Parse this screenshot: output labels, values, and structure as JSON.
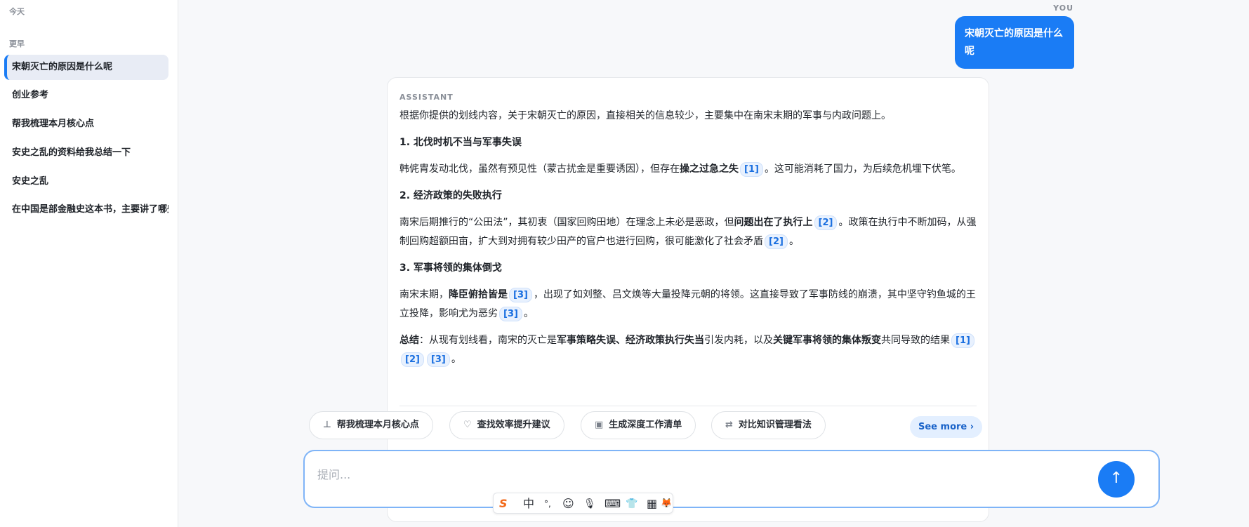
{
  "sidebar": {
    "groups": [
      {
        "label": "今天"
      },
      {
        "label": "更早"
      }
    ],
    "items": [
      {
        "label": "宋朝灭亡的原因是什么呢",
        "active": true
      },
      {
        "label": "创业参考"
      },
      {
        "label": "帮我梳理本月核心点"
      },
      {
        "label": "安史之乱的资料给我总结一下"
      },
      {
        "label": "安史之乱"
      },
      {
        "label": "在中国是部金融史这本书，主要讲了哪些内容"
      }
    ]
  },
  "chat": {
    "you_label": "YOU",
    "user_message": "宋朝灭亡的原因是什么呢",
    "assistant_label": "ASSISTANT",
    "answer": {
      "intro": "根据你提供的划线内容，关于宋朝灭亡的原因，直接相关的信息较少，主要集中在南宋末期的军事与内政问题上。",
      "s1_title": "1. 北伐时机不当与军事失误",
      "s1_a": "韩侂胄发动北伐，虽然有预见性（蒙古扰金是重要诱因），但存在",
      "s1_bold": "操之过急之失",
      "s1_b": "。这可能消耗了国力，为后续危机埋下伏笔。",
      "s2_title": "2. 经济政策的失败执行",
      "s2_a": "南宋后期推行的“公田法”，其初衷（国家回购田地）在理念上未必是恶政，但",
      "s2_bold": "问题出在了执行上",
      "s2_b": "。政策在执行中不断加码，从强制回购超额田亩，扩大到对拥有较少田产的官户也进行回购，很可能激化了社会矛盾",
      "s2_c": "。",
      "s3_title": "3. 军事将领的集体倒戈",
      "s3_a": "南宋末期，",
      "s3_bold": "降臣俯拾皆是",
      "s3_b": "，出现了如刘整、吕文焕等大量投降元朝的将领。这直接导致了军事防线的崩溃，其中坚守钓鱼城的王立投降，影响尤为恶劣",
      "s3_c": "。",
      "sum_label": "总结",
      "sum_a": "：从现有划线看，南宋的灭亡是",
      "sum_bold1": "军事策略失误、经济政策执行失当",
      "sum_b": "引发内耗，以及",
      "sum_bold2": "关键军事将领的集体叛变",
      "sum_c": "共同导致的结果",
      "sum_d": "。",
      "cites": [
        "[1]",
        "[2]",
        "[3]"
      ]
    }
  },
  "suggestions": [
    {
      "label": "帮我梳理本月核心点",
      "icon": "chart-icon"
    },
    {
      "label": "查找效率提升建议",
      "icon": "lightbulb-icon"
    },
    {
      "label": "生成深度工作清单",
      "icon": "clipboard-icon"
    },
    {
      "label": "对比知识管理看法",
      "icon": "swap-icon"
    }
  ],
  "see_more": "See more ›",
  "input": {
    "placeholder": "提问...",
    "value": ""
  },
  "ime": {
    "logo": "S",
    "mode": "中",
    "punct": "°,",
    "emoji": "☺",
    "mic": "🎙",
    "keyboard": "⌨",
    "skin": "👕",
    "apps": "▦",
    "extra": "🦊"
  },
  "colors": {
    "accent": "#1a7cf5",
    "cite_bg": "#e8f1fe"
  }
}
